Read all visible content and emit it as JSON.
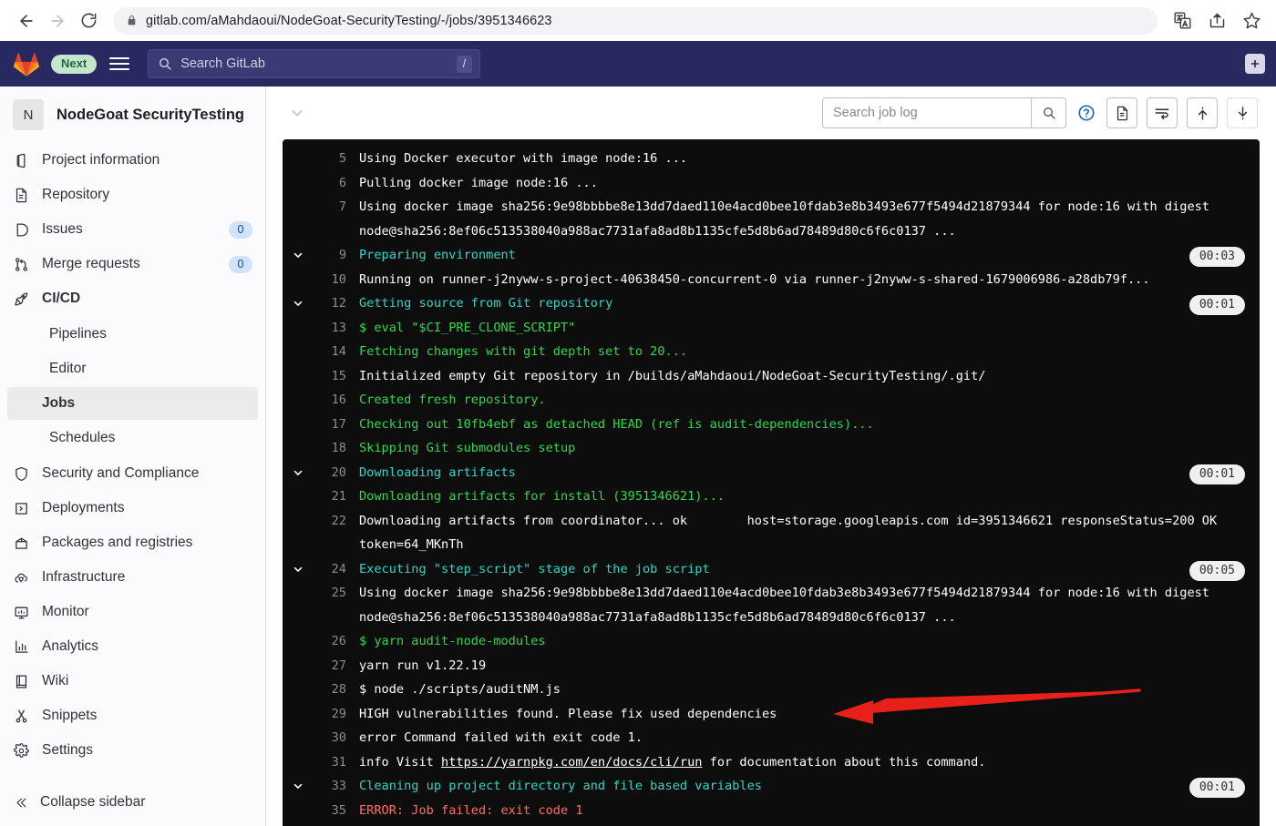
{
  "browser": {
    "back_icon": "back-arrow-icon",
    "forward_icon": "forward-arrow-icon",
    "reload_icon": "reload-icon",
    "lock_icon": "lock-icon",
    "url": "gitlab.com/aMahdaoui/NodeGoat-SecurityTesting/-/jobs/3951346623",
    "translate_icon": "translate-icon",
    "share_icon": "share-icon",
    "bookmark_icon": "star-icon"
  },
  "navbar": {
    "logo_icon": "gitlab-logo-icon",
    "next_badge": "Next",
    "menu_icon": "hamburger-menu-icon",
    "search_placeholder": "Search GitLab",
    "search_icon": "search-icon",
    "slash_shortcut": "/",
    "plus_label": "+",
    "bg_color": "#292961",
    "badge_bg": "#c3e6cd",
    "badge_fg": "#24663b"
  },
  "sidebar": {
    "project_initial": "N",
    "project_name": "NodeGoat SecurityTesting",
    "items": [
      {
        "label": "Project information",
        "icon": "project-information-icon",
        "badge": null,
        "bold": false
      },
      {
        "label": "Repository",
        "icon": "repository-icon",
        "badge": null,
        "bold": false
      },
      {
        "label": "Issues",
        "icon": "issues-icon",
        "badge": "0",
        "bold": false
      },
      {
        "label": "Merge requests",
        "icon": "merge-requests-icon",
        "badge": "0",
        "bold": false
      },
      {
        "label": "CI/CD",
        "icon": "rocket-icon",
        "badge": null,
        "bold": true
      }
    ],
    "cicd_subitems": [
      {
        "label": "Pipelines",
        "active": false
      },
      {
        "label": "Editor",
        "active": false
      },
      {
        "label": "Jobs",
        "active": true
      },
      {
        "label": "Schedules",
        "active": false
      }
    ],
    "items_after": [
      {
        "label": "Security and Compliance",
        "icon": "shield-icon",
        "badge": null,
        "bold": false
      },
      {
        "label": "Deployments",
        "icon": "deployments-icon",
        "badge": null,
        "bold": false
      },
      {
        "label": "Packages and registries",
        "icon": "package-icon",
        "badge": null,
        "bold": false
      },
      {
        "label": "Infrastructure",
        "icon": "infrastructure-cloud-icon",
        "badge": null,
        "bold": false
      },
      {
        "label": "Monitor",
        "icon": "monitor-icon",
        "badge": null,
        "bold": false
      },
      {
        "label": "Analytics",
        "icon": "analytics-chart-icon",
        "badge": null,
        "bold": false
      },
      {
        "label": "Wiki",
        "icon": "wiki-book-icon",
        "badge": null,
        "bold": false
      },
      {
        "label": "Snippets",
        "icon": "snippets-scissors-icon",
        "badge": null,
        "bold": false
      },
      {
        "label": "Settings",
        "icon": "gear-icon",
        "badge": null,
        "bold": false
      }
    ],
    "collapse_label": "Collapse sidebar",
    "collapse_icon": "double-chevron-left-icon",
    "badge_bg": "#cfe3fa",
    "badge_fg": "#0b4a8f"
  },
  "log_toolbar": {
    "collapse_icon": "chevron-down-icon",
    "search_placeholder": "Search job log",
    "search_button_icon": "search-icon",
    "help_icon": "question-circle-icon",
    "raw_icon": "raw-file-icon",
    "wrap_icon": "soft-wrap-icon",
    "scroll_top_icon": "scroll-to-top-icon",
    "scroll_bottom_icon": "scroll-to-bottom-icon"
  },
  "log": {
    "bg_color": "#0d0d0d",
    "colors": {
      "default": "#ffffff",
      "green": "#32d74b",
      "cyan": "#2bd9c9",
      "red": "#ff6f63",
      "line_number": "#8d8d8d"
    },
    "lines": [
      {
        "num": "5",
        "text": "Using Docker executor with image node:16 ...",
        "color": "default",
        "collapsible": false,
        "duration": null
      },
      {
        "num": "6",
        "text": "Pulling docker image node:16 ...",
        "color": "default",
        "collapsible": false,
        "duration": null
      },
      {
        "num": "7",
        "text": "Using docker image sha256:9e98bbbbe8e13dd7daed110e4acd0bee10fdab3e8b3493e677f5494d21879344 for node:16 with digest node@sha256:8ef06c513538040a988ac7731afa8ad8b1135cfe5d8b6ad78489d80c6f6c0137 ...",
        "color": "default",
        "collapsible": false,
        "duration": null
      },
      {
        "num": "9",
        "text": "Preparing environment",
        "color": "cyan",
        "collapsible": true,
        "duration": "00:03"
      },
      {
        "num": "10",
        "text": "Running on runner-j2nyww-s-project-40638450-concurrent-0 via runner-j2nyww-s-shared-1679006986-a28db79f...",
        "color": "default",
        "collapsible": false,
        "duration": null
      },
      {
        "num": "12",
        "text": "Getting source from Git repository",
        "color": "cyan",
        "collapsible": true,
        "duration": "00:01"
      },
      {
        "num": "13",
        "text": "$ eval \"$CI_PRE_CLONE_SCRIPT\"",
        "color": "green",
        "collapsible": false,
        "duration": null
      },
      {
        "num": "14",
        "text": "Fetching changes with git depth set to 20...",
        "color": "green",
        "collapsible": false,
        "duration": null
      },
      {
        "num": "15",
        "text": "Initialized empty Git repository in /builds/aMahdaoui/NodeGoat-SecurityTesting/.git/",
        "color": "default",
        "collapsible": false,
        "duration": null
      },
      {
        "num": "16",
        "text": "Created fresh repository.",
        "color": "green",
        "collapsible": false,
        "duration": null
      },
      {
        "num": "17",
        "text": "Checking out 10fb4ebf as detached HEAD (ref is audit-dependencies)...",
        "color": "green",
        "collapsible": false,
        "duration": null
      },
      {
        "num": "18",
        "text": "Skipping Git submodules setup",
        "color": "green",
        "collapsible": false,
        "duration": null
      },
      {
        "num": "20",
        "text": "Downloading artifacts",
        "color": "cyan",
        "collapsible": true,
        "duration": "00:01"
      },
      {
        "num": "21",
        "text": "Downloading artifacts for install (3951346621)...",
        "color": "green",
        "collapsible": false,
        "duration": null
      },
      {
        "num": "22",
        "text": "Downloading artifacts from coordinator... ok        host=storage.googleapis.com id=3951346621 responseStatus=200 OK token=64_MKnTh",
        "color": "default",
        "collapsible": false,
        "duration": null
      },
      {
        "num": "24",
        "text": "Executing \"step_script\" stage of the job script",
        "color": "cyan",
        "collapsible": true,
        "duration": "00:05"
      },
      {
        "num": "25",
        "text": "Using docker image sha256:9e98bbbbe8e13dd7daed110e4acd0bee10fdab3e8b3493e677f5494d21879344 for node:16 with digest node@sha256:8ef06c513538040a988ac7731afa8ad8b1135cfe5d8b6ad78489d80c6f6c0137 ...",
        "color": "default",
        "collapsible": false,
        "duration": null
      },
      {
        "num": "26",
        "text": "$ yarn audit-node-modules",
        "color": "green",
        "collapsible": false,
        "duration": null
      },
      {
        "num": "27",
        "text": "yarn run v1.22.19",
        "color": "default",
        "collapsible": false,
        "duration": null
      },
      {
        "num": "28",
        "text": "$ node ./scripts/auditNM.js",
        "color": "default",
        "collapsible": false,
        "duration": null
      },
      {
        "num": "29",
        "text": "HIGH vulnerabilities found. Please fix used dependencies",
        "color": "default",
        "collapsible": false,
        "duration": null,
        "annotated": true
      },
      {
        "num": "30",
        "text": "error Command failed with exit code 1.",
        "color": "default",
        "collapsible": false,
        "duration": null
      },
      {
        "num": "31",
        "text": "info Visit https://yarnpkg.com/en/docs/cli/run for documentation about this command.",
        "color": "default",
        "collapsible": false,
        "duration": null,
        "link": "https://yarnpkg.com/en/docs/cli/run"
      },
      {
        "num": "33",
        "text": "Cleaning up project directory and file based variables",
        "color": "cyan",
        "collapsible": true,
        "duration": "00:01"
      },
      {
        "num": "35",
        "text": "ERROR: Job failed: exit code 1",
        "color": "red",
        "collapsible": false,
        "duration": null
      }
    ]
  },
  "annotation": {
    "type": "arrow",
    "color": "#e8201a",
    "points_at_line": "29"
  }
}
